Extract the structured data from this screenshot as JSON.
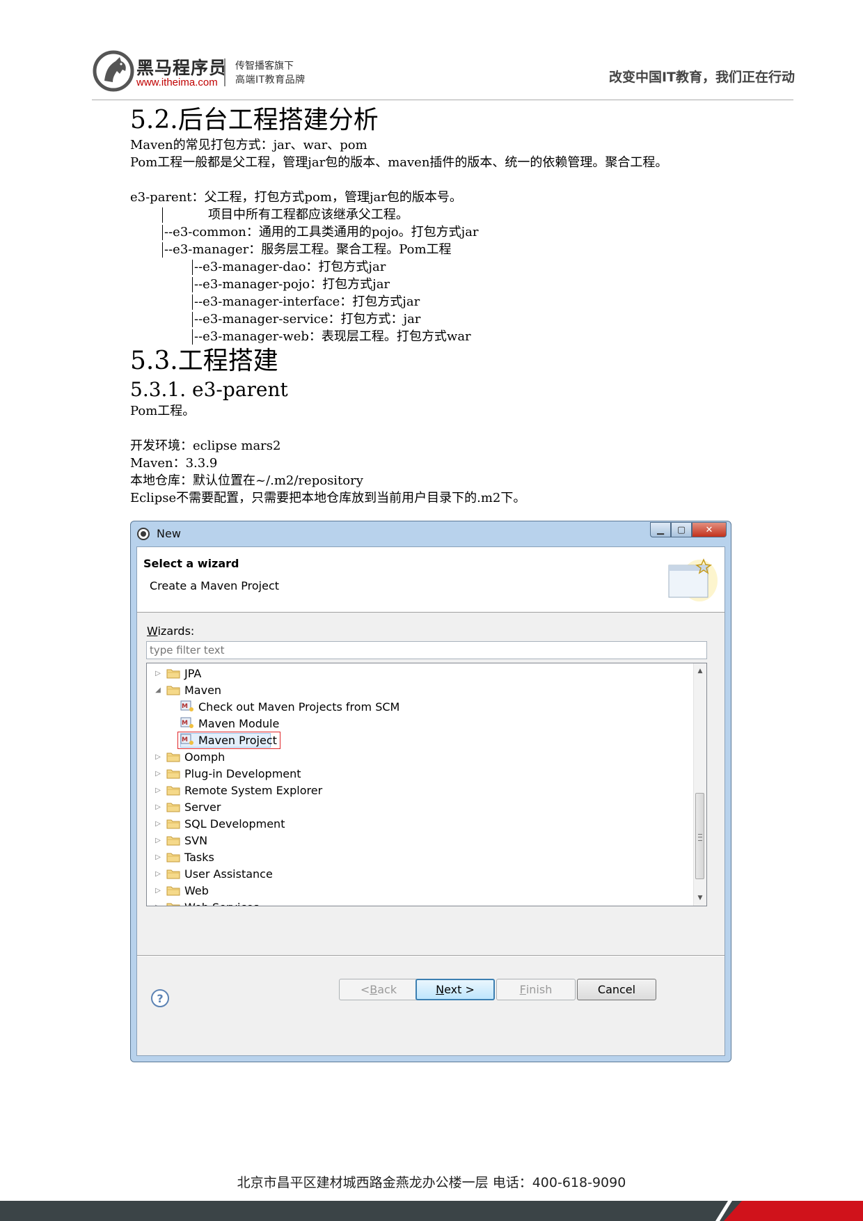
{
  "header": {
    "brand_name": "黑马程序员",
    "brand_url": "www.itheima.com",
    "brand_sub1": "传智播客旗下",
    "brand_sub2": "高端IT教育品牌",
    "slogan": "改变中国IT教育，我们正在行动"
  },
  "doc": {
    "s52_title": "5.2.后台工程搭建分析",
    "p1": "Maven的常见打包方式：jar、war、pom",
    "p2": "Pom工程一般都是父工程，管理jar包的版本、maven插件的版本、统一的依赖管理。聚合工程。",
    "tree": [
      "e3-parent：父工程，打包方式pom，管理jar包的版本号。",
      "           项目中所有工程都应该继承父工程。",
      "--e3-common：通用的工具类通用的pojo。打包方式jar",
      "--e3-manager：服务层工程。聚合工程。Pom工程",
      "--e3-manager-dao：打包方式jar",
      "--e3-manager-pojo：打包方式jar",
      "--e3-manager-interface：打包方式jar",
      "--e3-manager-service：打包方式：jar",
      "--e3-manager-web：表现层工程。打包方式war"
    ],
    "s53_title": "5.3.工程搭建",
    "s531_title": "5.3.1. e3-parent",
    "p3": "Pom工程。",
    "env": "开发环境：eclipse mars2",
    "maven": "Maven：3.3.9",
    "repo": "本地仓库：默认位置在~/.m2/repository",
    "eclipse": "Eclipse不需要配置，只需要把本地仓库放到当前用户目录下的.m2下。"
  },
  "dialog": {
    "title": "New",
    "banner_title": "Select a wizard",
    "banner_desc": "Create a Maven Project",
    "wizards_label_u": "W",
    "wizards_label_rest": "izards:",
    "filter_placeholder": "type filter text",
    "items": [
      {
        "label": "JPA",
        "kind": "folder"
      },
      {
        "label": "Maven",
        "kind": "folder-open"
      },
      {
        "label": "Check out Maven Projects from SCM",
        "kind": "child"
      },
      {
        "label": "Maven Module",
        "kind": "child"
      },
      {
        "label": "Maven Project",
        "kind": "child-selected"
      },
      {
        "label": "Oomph",
        "kind": "folder"
      },
      {
        "label": "Plug-in Development",
        "kind": "folder"
      },
      {
        "label": "Remote System Explorer",
        "kind": "folder"
      },
      {
        "label": "Server",
        "kind": "folder"
      },
      {
        "label": "SQL Development",
        "kind": "folder"
      },
      {
        "label": "SVN",
        "kind": "folder"
      },
      {
        "label": "Tasks",
        "kind": "folder"
      },
      {
        "label": "User Assistance",
        "kind": "folder"
      },
      {
        "label": "Web",
        "kind": "folder"
      },
      {
        "label": "Web Services",
        "kind": "folder"
      }
    ],
    "buttons": {
      "back_pre": "< ",
      "back_u": "B",
      "back_rest": "ack",
      "next_u": "N",
      "next_rest": "ext >",
      "finish_u": "F",
      "finish_rest": "inish",
      "cancel": "Cancel"
    },
    "help": "?"
  },
  "footer": {
    "address": "北京市昌平区建材城西路金燕龙办公楼一层   电话：400-618-9090"
  }
}
